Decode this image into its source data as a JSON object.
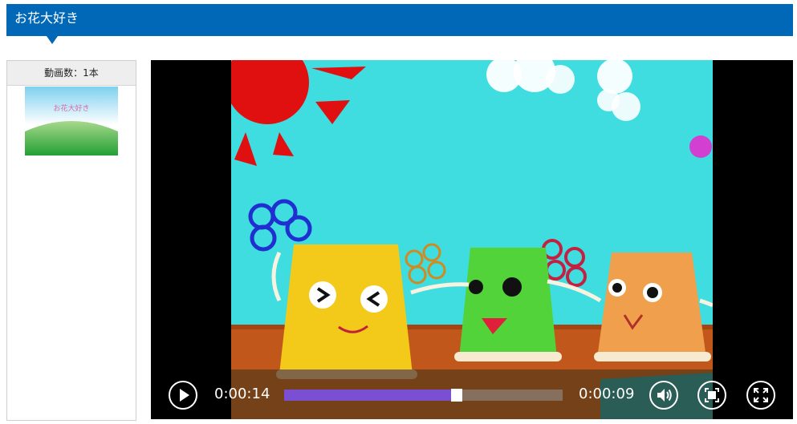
{
  "header": {
    "title": "お花大好き"
  },
  "sidebar": {
    "count_label": "動画数：1本",
    "thumbnail": {
      "caption": "お花大好き"
    }
  },
  "player": {
    "elapsed": "0:00:14",
    "remaining": "0:00:09",
    "progress_fraction": 0.6,
    "accent_color": "#7b4fd1"
  },
  "colors": {
    "header_bg": "#0068b7",
    "sidebar_header_bg": "#eeeeee"
  }
}
